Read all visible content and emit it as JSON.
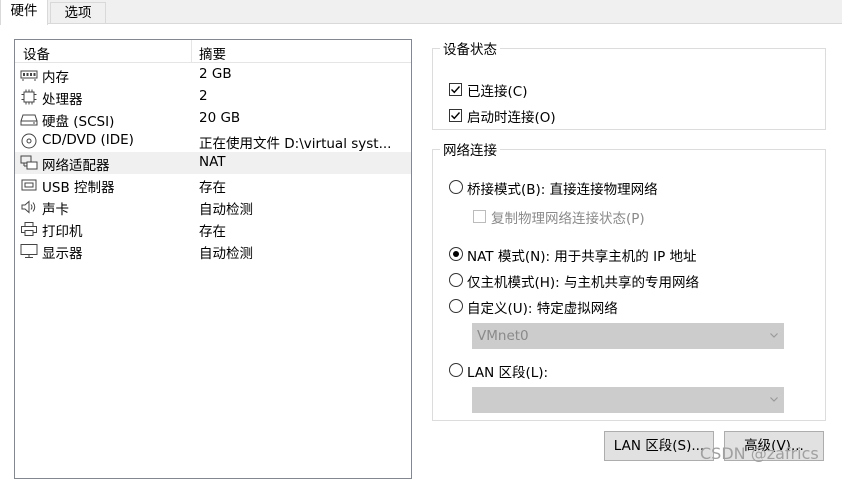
{
  "tabs": [
    {
      "label": "硬件",
      "active": true
    },
    {
      "label": "选项",
      "active": false
    }
  ],
  "device_list": {
    "columns": [
      "设备",
      "摘要"
    ],
    "rows": [
      {
        "name": "内存",
        "summary": "2 GB",
        "icon": "memory-icon"
      },
      {
        "name": "处理器",
        "summary": "2",
        "icon": "cpu-icon"
      },
      {
        "name": "硬盘 (SCSI)",
        "summary": "20 GB",
        "icon": "hard-disk-icon"
      },
      {
        "name": "CD/DVD (IDE)",
        "summary": "正在使用文件 D:\\virtual syst...",
        "icon": "cd-dvd-icon"
      },
      {
        "name": "网络适配器",
        "summary": "NAT",
        "icon": "network-adapter-icon",
        "selected": true
      },
      {
        "name": "USB 控制器",
        "summary": "存在",
        "icon": "usb-icon"
      },
      {
        "name": "声卡",
        "summary": "自动检测",
        "icon": "speaker-icon"
      },
      {
        "name": "打印机",
        "summary": "存在",
        "icon": "printer-icon"
      },
      {
        "name": "显示器",
        "summary": "自动检测",
        "icon": "monitor-icon"
      }
    ]
  },
  "device_status": {
    "title": "设备状态",
    "connected": {
      "label": "已连接(C)",
      "checked": true
    },
    "connect_on_start": {
      "label": "启动时连接(O)",
      "checked": true
    }
  },
  "network_connection": {
    "title": "网络连接",
    "bridged": {
      "label": "桥接模式(B): 直接连接物理网络",
      "selected": false
    },
    "replicate": {
      "label": "复制物理网络连接状态(P)",
      "checked": false,
      "disabled": true
    },
    "nat": {
      "label": "NAT 模式(N): 用于共享主机的 IP 地址",
      "selected": true
    },
    "host_only": {
      "label": "仅主机模式(H): 与主机共享的专用网络",
      "selected": false
    },
    "custom": {
      "label": "自定义(U): 特定虚拟网络",
      "selected": false
    },
    "custom_select": {
      "value": "VMnet0",
      "disabled": true
    },
    "lan_segment": {
      "label": "LAN 区段(L):",
      "selected": false
    },
    "lan_select": {
      "value": "",
      "disabled": true
    }
  },
  "buttons": {
    "lan_segments": "LAN 区段(S)...",
    "advanced": "高级(V)..."
  },
  "watermark": "CSDN @zafrics"
}
